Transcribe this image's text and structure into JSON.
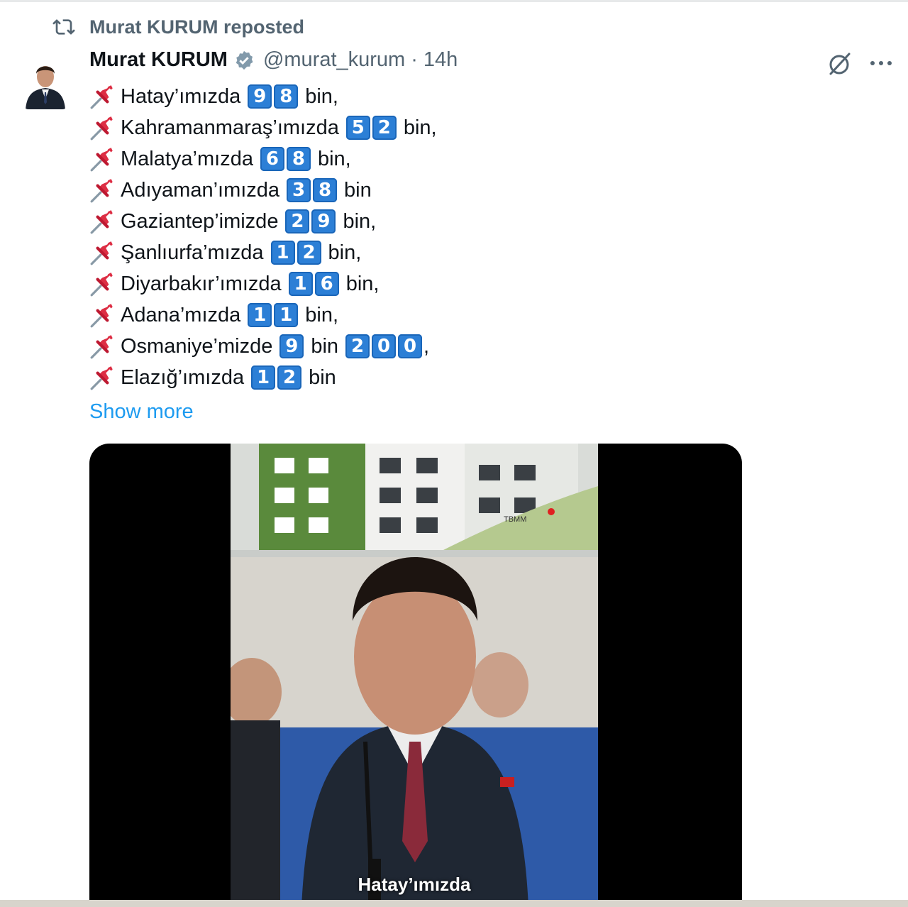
{
  "repost": {
    "label": "Murat KURUM reposted",
    "icon": "repost-icon"
  },
  "author": {
    "name": "Murat KURUM",
    "handle": "@murat_kurum",
    "separator": "·",
    "time": "14h",
    "verified": true
  },
  "lines": [
    {
      "pre": "Hatay’ımızda",
      "digits": [
        "9",
        "8"
      ],
      "post": "bin,",
      "digits2": [],
      "post2": ""
    },
    {
      "pre": "Kahramanmaraş’ımızda",
      "digits": [
        "5",
        "2"
      ],
      "post": "bin,",
      "digits2": [],
      "post2": ""
    },
    {
      "pre": "Malatya’mızda",
      "digits": [
        "6",
        "8"
      ],
      "post": "bin,",
      "digits2": [],
      "post2": ""
    },
    {
      "pre": "Adıyaman’ımızda",
      "digits": [
        "3",
        "8"
      ],
      "post": "bin",
      "digits2": [],
      "post2": ""
    },
    {
      "pre": "Gaziantep’imizde",
      "digits": [
        "2",
        "9"
      ],
      "post": "bin,",
      "digits2": [],
      "post2": ""
    },
    {
      "pre": "Şanlıurfa’mızda",
      "digits": [
        "1",
        "2"
      ],
      "post": "bin,",
      "digits2": [],
      "post2": ""
    },
    {
      "pre": "Diyarbakır’ımızda",
      "digits": [
        "1",
        "6"
      ],
      "post": "bin,",
      "digits2": [],
      "post2": ""
    },
    {
      "pre": "Adana’mızda",
      "digits": [
        "1",
        "1"
      ],
      "post": "bin,",
      "digits2": [],
      "post2": ""
    },
    {
      "pre": "Osmaniye’mizde",
      "digits": [
        "9"
      ],
      "post": "bin",
      "digits2": [
        "2",
        "0",
        "0"
      ],
      "post2": ","
    },
    {
      "pre": "Elazığ’ımızda",
      "digits": [
        "1",
        "2"
      ],
      "post": "bin",
      "digits2": [],
      "post2": ""
    }
  ],
  "show_more": "Show more",
  "media": {
    "banner_text": "TBMM",
    "caption": "Hatay’ımızda"
  },
  "icons": {
    "grok": "grok-icon",
    "more": "more-options-icon",
    "pin": "pushpin-icon",
    "verified": "verified-badge-icon"
  },
  "colors": {
    "link": "#1d9bf0",
    "muted": "#536471",
    "keycap": "#2c7fd6"
  }
}
